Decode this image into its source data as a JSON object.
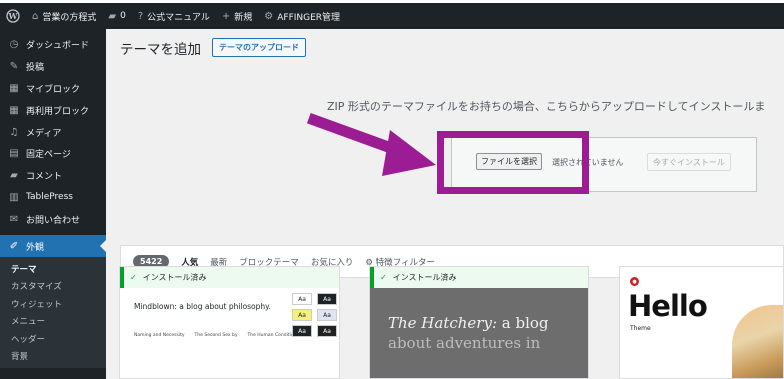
{
  "adminbar": {
    "site_name": "営業の方程式",
    "comments_count": "0",
    "manual": "公式マニュアル",
    "new": "新規",
    "affinger": "AFFINGER管理"
  },
  "sidebar": {
    "items": [
      {
        "label": "ダッシュボード",
        "icon": "dashboard-icon"
      },
      {
        "label": "投稿",
        "icon": "pin-icon"
      },
      {
        "label": "マイブロック",
        "icon": "grid-icon"
      },
      {
        "label": "再利用ブロック",
        "icon": "grid-icon"
      },
      {
        "label": "メディア",
        "icon": "media-icon"
      },
      {
        "label": "固定ページ",
        "icon": "page-icon"
      },
      {
        "label": "コメント",
        "icon": "comment-icon"
      },
      {
        "label": "TablePress",
        "icon": "table-icon"
      },
      {
        "label": "お問い合わせ",
        "icon": "mail-icon"
      }
    ],
    "current": {
      "label": "外観",
      "icon": "brush-icon"
    },
    "submenu": [
      "テーマ",
      "カスタマイズ",
      "ウィジェット",
      "メニュー",
      "ヘッダー",
      "背景"
    ]
  },
  "main": {
    "title": "テーマを追加",
    "upload_button": "テーマのアップロード",
    "upload_description": "ZIP 形式のテーマファイルをお持ちの場合、こちらからアップロードしてインストールま",
    "file_button": "ファイルを選択",
    "file_status": "選択されていません",
    "install_button": "今すぐインストール"
  },
  "filter": {
    "count": "5422",
    "tabs": [
      "人気",
      "最新",
      "ブロックテーマ",
      "お気に入り"
    ],
    "feature_filter": "特徴フィルター"
  },
  "themes": [
    {
      "installed_label": "インストール済み",
      "preview_title": "Mindblown: a blog about philosophy.",
      "preview_links": [
        "Naming and Necessity",
        "The Second Sex by",
        "The Human Condition"
      ],
      "swatch_label": "Aa"
    },
    {
      "installed_label": "インストール済み",
      "preview_title_italic": "The Hatchery:",
      "preview_title_rest": " a blog",
      "preview_subtitle": "about adventures in"
    },
    {
      "preview_hello": "Hello",
      "preview_theme": "Theme"
    }
  ],
  "colors": {
    "adminbar_bg": "#1d2327",
    "accent": "#2271b1",
    "annotation": "#9c1d93",
    "installed_green": "#00a32a"
  }
}
